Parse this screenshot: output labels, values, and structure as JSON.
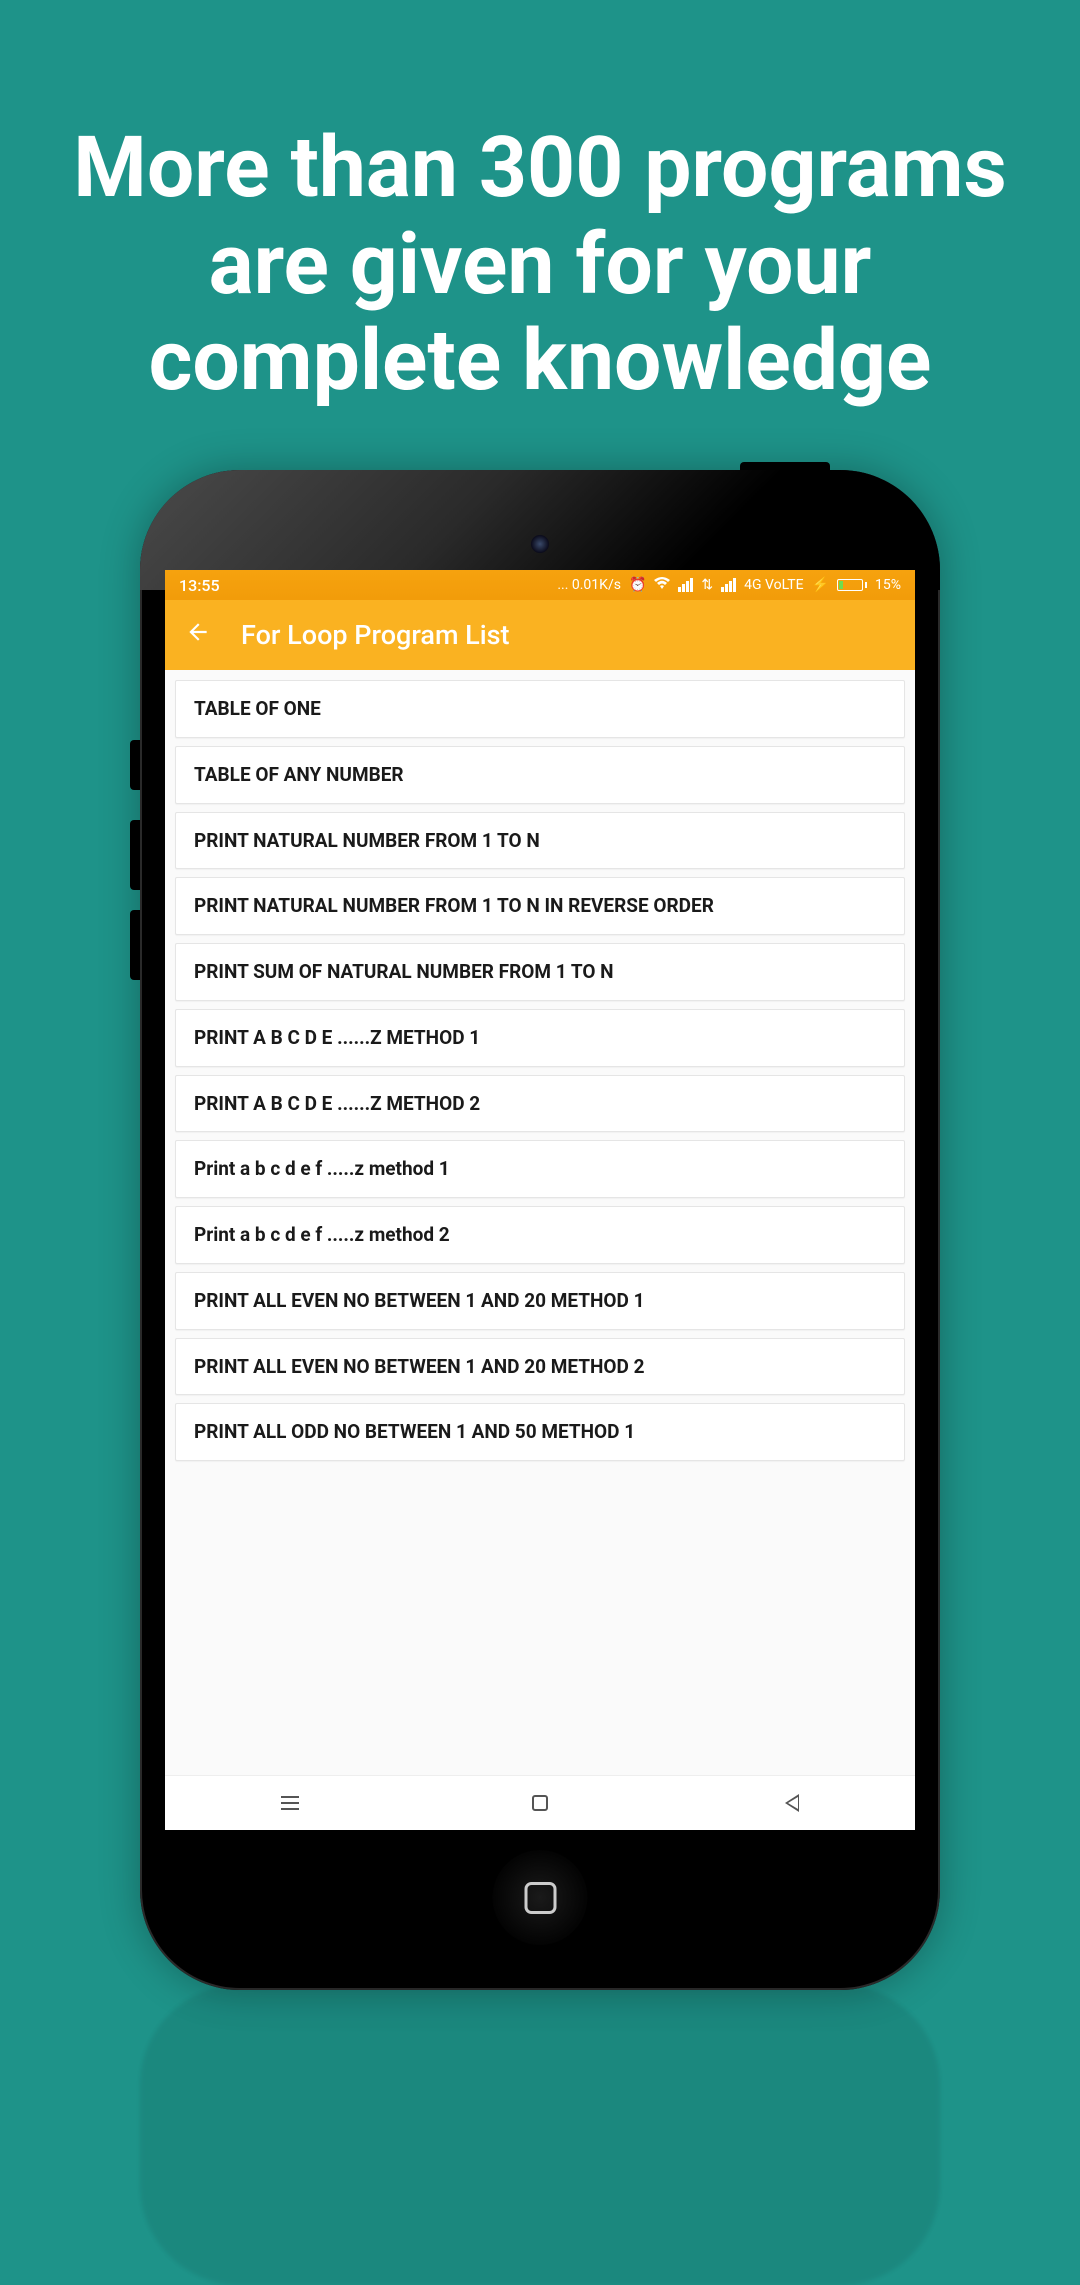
{
  "headline": "More than 300 programs are given for your complete knowledge",
  "status": {
    "time": "13:55",
    "speed": "... 0.01K/s",
    "network_label": "4G VoLTE",
    "battery_pct": "15%"
  },
  "appbar": {
    "title": "For Loop Program List"
  },
  "programs": [
    "TABLE OF ONE",
    "TABLE OF ANY NUMBER",
    "PRINT NATURAL NUMBER FROM 1 TO N",
    "PRINT NATURAL NUMBER FROM 1 TO N IN REVERSE ORDER",
    "PRINT SUM OF  NATURAL NUMBER FROM 1 TO N",
    "PRINT A B C D E ......Z METHOD 1",
    "PRINT A B C D E ......Z METHOD 2",
    "Print a b c d e f .....z method 1",
    "Print a b c d e f .....z method 2",
    "PRINT ALL EVEN NO BETWEEN 1 AND 20 METHOD 1",
    "PRINT ALL EVEN NO BETWEEN 1 AND 20 METHOD 2",
    "PRINT ALL ODD NO BETWEEN 1 AND 50 METHOD 1"
  ]
}
